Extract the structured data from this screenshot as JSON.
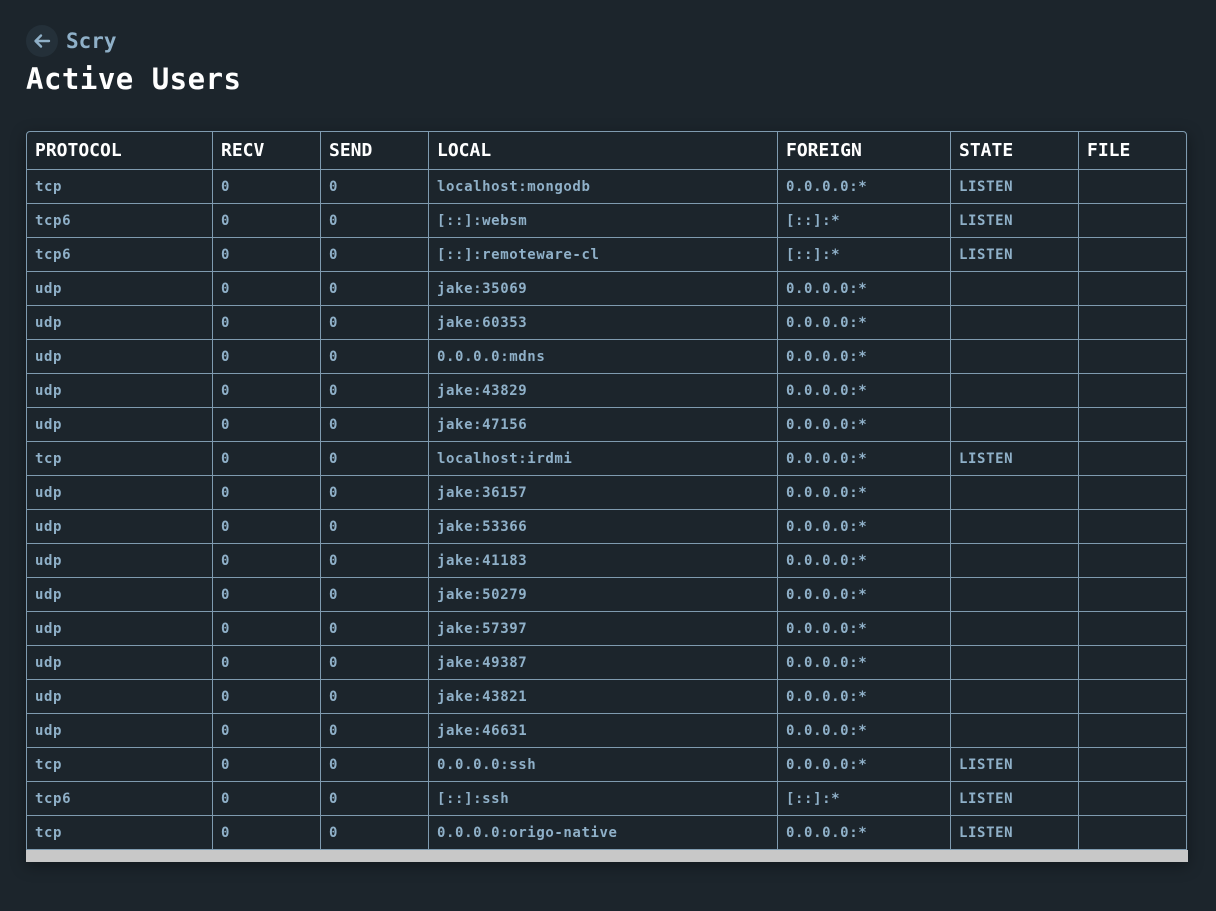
{
  "app": {
    "name": "Scry",
    "back_icon": "arrow-left-icon"
  },
  "page": {
    "title": "Active Users"
  },
  "colors": {
    "background": "#1c252c",
    "accent_text": "#8fb0c8",
    "border": "#7f9bb0",
    "header_text": "#ffffff"
  },
  "table": {
    "columns": [
      "PROTOCOL",
      "RECV",
      "SEND",
      "LOCAL",
      "FOREIGN",
      "STATE",
      "FILE"
    ],
    "rows": [
      {
        "protocol": "tcp",
        "recv": "0",
        "send": "0",
        "local": "localhost:mongodb",
        "foreign": "0.0.0.0:*",
        "state": "LISTEN",
        "file": ""
      },
      {
        "protocol": "tcp6",
        "recv": "0",
        "send": "0",
        "local": "[::]:websm",
        "foreign": "[::]:*",
        "state": "LISTEN",
        "file": ""
      },
      {
        "protocol": "tcp6",
        "recv": "0",
        "send": "0",
        "local": "[::]:remoteware-cl",
        "foreign": "[::]:*",
        "state": "LISTEN",
        "file": ""
      },
      {
        "protocol": "udp",
        "recv": "0",
        "send": "0",
        "local": "jake:35069",
        "foreign": "0.0.0.0:*",
        "state": "",
        "file": ""
      },
      {
        "protocol": "udp",
        "recv": "0",
        "send": "0",
        "local": "jake:60353",
        "foreign": "0.0.0.0:*",
        "state": "",
        "file": ""
      },
      {
        "protocol": "udp",
        "recv": "0",
        "send": "0",
        "local": "0.0.0.0:mdns",
        "foreign": "0.0.0.0:*",
        "state": "",
        "file": ""
      },
      {
        "protocol": "udp",
        "recv": "0",
        "send": "0",
        "local": "jake:43829",
        "foreign": "0.0.0.0:*",
        "state": "",
        "file": ""
      },
      {
        "protocol": "udp",
        "recv": "0",
        "send": "0",
        "local": "jake:47156",
        "foreign": "0.0.0.0:*",
        "state": "",
        "file": ""
      },
      {
        "protocol": "tcp",
        "recv": "0",
        "send": "0",
        "local": "localhost:irdmi",
        "foreign": "0.0.0.0:*",
        "state": "LISTEN",
        "file": ""
      },
      {
        "protocol": "udp",
        "recv": "0",
        "send": "0",
        "local": "jake:36157",
        "foreign": "0.0.0.0:*",
        "state": "",
        "file": ""
      },
      {
        "protocol": "udp",
        "recv": "0",
        "send": "0",
        "local": "jake:53366",
        "foreign": "0.0.0.0:*",
        "state": "",
        "file": ""
      },
      {
        "protocol": "udp",
        "recv": "0",
        "send": "0",
        "local": "jake:41183",
        "foreign": "0.0.0.0:*",
        "state": "",
        "file": ""
      },
      {
        "protocol": "udp",
        "recv": "0",
        "send": "0",
        "local": "jake:50279",
        "foreign": "0.0.0.0:*",
        "state": "",
        "file": ""
      },
      {
        "protocol": "udp",
        "recv": "0",
        "send": "0",
        "local": "jake:57397",
        "foreign": "0.0.0.0:*",
        "state": "",
        "file": ""
      },
      {
        "protocol": "udp",
        "recv": "0",
        "send": "0",
        "local": "jake:49387",
        "foreign": "0.0.0.0:*",
        "state": "",
        "file": ""
      },
      {
        "protocol": "udp",
        "recv": "0",
        "send": "0",
        "local": "jake:43821",
        "foreign": "0.0.0.0:*",
        "state": "",
        "file": ""
      },
      {
        "protocol": "udp",
        "recv": "0",
        "send": "0",
        "local": "jake:46631",
        "foreign": "0.0.0.0:*",
        "state": "",
        "file": ""
      },
      {
        "protocol": "tcp",
        "recv": "0",
        "send": "0",
        "local": "0.0.0.0:ssh",
        "foreign": "0.0.0.0:*",
        "state": "LISTEN",
        "file": ""
      },
      {
        "protocol": "tcp6",
        "recv": "0",
        "send": "0",
        "local": "[::]:ssh",
        "foreign": "[::]:*",
        "state": "LISTEN",
        "file": ""
      },
      {
        "protocol": "tcp",
        "recv": "0",
        "send": "0",
        "local": "0.0.0.0:origo-native",
        "foreign": "0.0.0.0:*",
        "state": "LISTEN",
        "file": ""
      }
    ]
  }
}
